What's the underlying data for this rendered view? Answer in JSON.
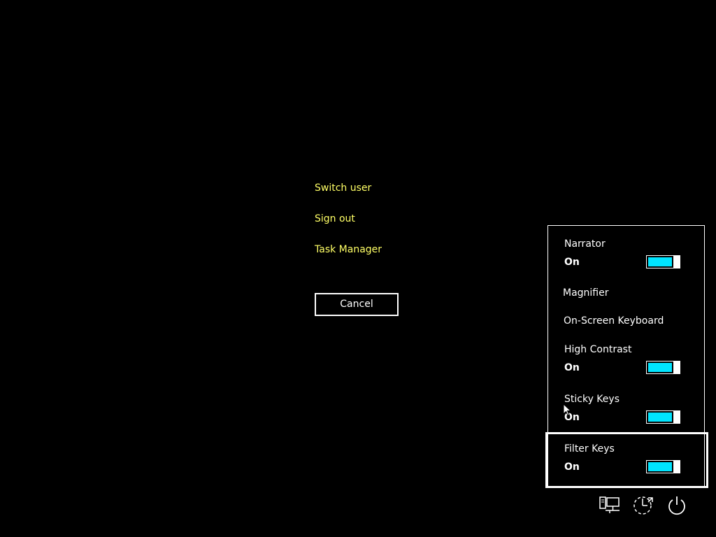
{
  "menu": {
    "switch_user": "Switch user",
    "sign_out": "Sign out",
    "task_manager": "Task Manager",
    "cancel": "Cancel"
  },
  "ease_of_access": {
    "items": [
      {
        "label": "Narrator",
        "state": "On",
        "toggle_on": true
      },
      {
        "label": "Magnifier"
      },
      {
        "label": "On-Screen Keyboard"
      },
      {
        "label": "High Contrast",
        "state": "On",
        "toggle_on": true
      },
      {
        "label": "Sticky Keys",
        "state": "On",
        "toggle_on": true
      },
      {
        "label": "Filter Keys",
        "state": "On",
        "toggle_on": true
      }
    ]
  },
  "bottom_icons": [
    "network-icon",
    "ease-of-access-icon",
    "power-icon"
  ],
  "colors": {
    "background": "#000000",
    "link": "#ffff66",
    "text": "#ffffff",
    "toggle_on": "#00e5ff"
  }
}
